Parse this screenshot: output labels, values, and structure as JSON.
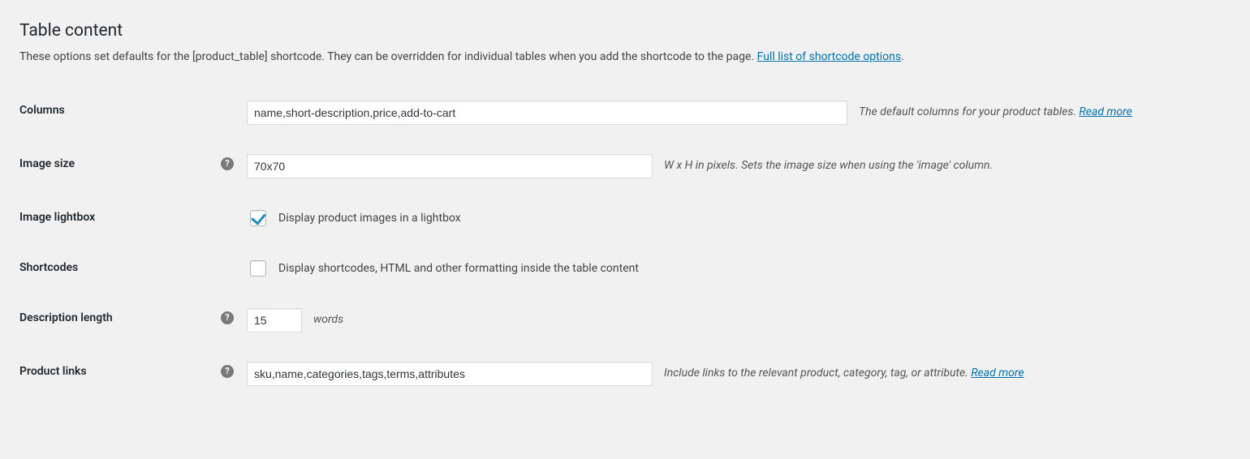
{
  "section": {
    "title": "Table content",
    "description_text": "These options set defaults for the [product_table] shortcode. They can be overridden for individual tables when you add the shortcode to the page. ",
    "description_link": "Full list of shortcode options",
    "period": "."
  },
  "fields": {
    "columns": {
      "label": "Columns",
      "value": "name,short-description,price,add-to-cart",
      "help_text": "The default columns for your product tables. ",
      "help_link": "Read more"
    },
    "image_size": {
      "label": "Image size",
      "value": "70x70",
      "help_text": "W x H in pixels. Sets the image size when using the 'image' column."
    },
    "image_lightbox": {
      "label": "Image lightbox",
      "checkbox_label": "Display product images in a lightbox",
      "checked": true
    },
    "shortcodes": {
      "label": "Shortcodes",
      "checkbox_label": "Display shortcodes, HTML and other formatting inside the table content",
      "checked": false
    },
    "description_length": {
      "label": "Description length",
      "value": "15",
      "unit": "words"
    },
    "product_links": {
      "label": "Product links",
      "value": "sku,name,categories,tags,terms,attributes",
      "help_text": "Include links to the relevant product, category, tag, or attribute. ",
      "help_link": "Read more"
    }
  }
}
